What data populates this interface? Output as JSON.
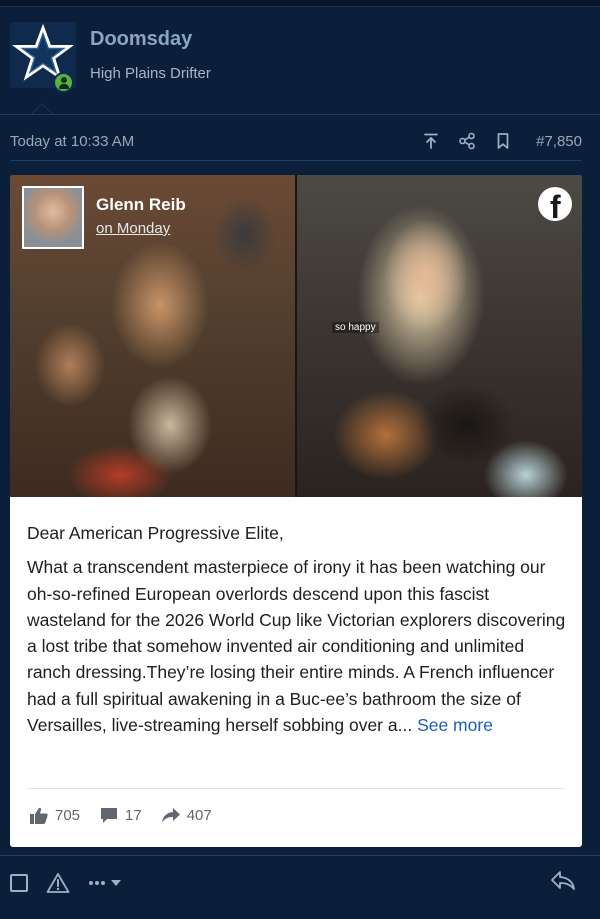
{
  "post": {
    "username": "Doomsday",
    "user_title": "High Plains Drifter",
    "timestamp": "Today at 10:33 AM",
    "post_number": "#7,850"
  },
  "embed": {
    "author": "Glenn Reib",
    "date": "on Monday",
    "photo_caption": "so happy",
    "greeting": "Dear American Progressive Elite,",
    "body": "What a transcendent masterpiece of irony it has been watching our oh-so-refined European overlords descend upon this fascist wasteland for the 2026 World Cup like Victorian explorers discovering a lost tribe that somehow invented air conditioning and unlimited ranch dressing.They’re losing their entire minds. A French influencer had a full spiritual awakening in a Buc-ee’s bathroom the size of Versailles, live-streaming herself sobbing over a...",
    "see_more": "See more",
    "likes": "705",
    "comments": "17",
    "shares": "407"
  },
  "colors": {
    "page_bg": "#0c1f3a",
    "username": "#8aa4c2",
    "online": "#57b33d",
    "link": "#1a5fb4"
  },
  "icons": [
    "star-icon",
    "user-online-icon",
    "share-up-icon",
    "share-nodes-icon",
    "bookmark-icon",
    "facebook-icon",
    "thumbs-up-icon",
    "comment-icon",
    "share-arrow-icon",
    "checkbox-icon",
    "warning-icon",
    "more-dots-icon",
    "chevron-down-icon",
    "reply-icon"
  ]
}
